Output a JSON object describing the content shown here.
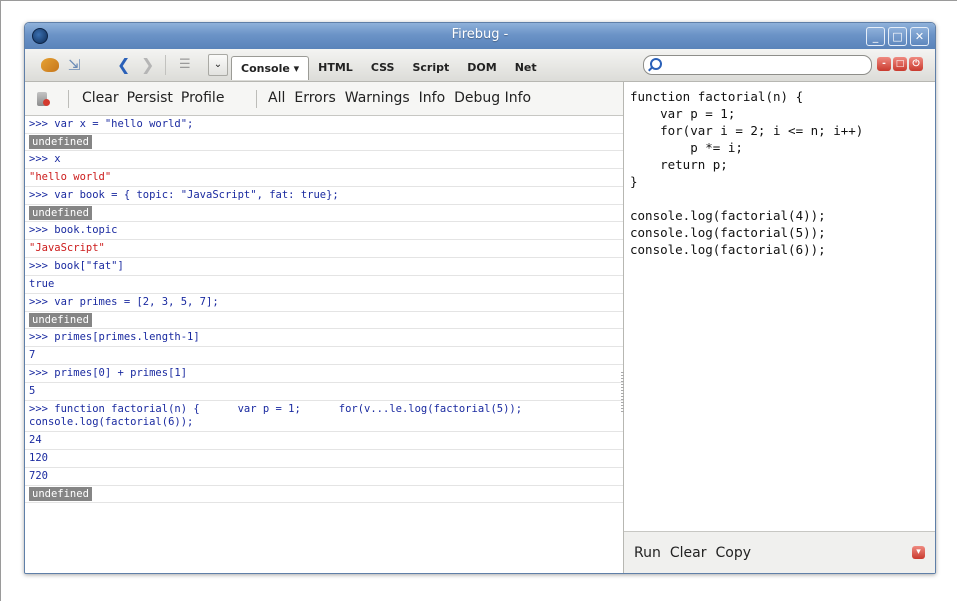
{
  "window": {
    "title": "Firebug -",
    "controls": [
      "_",
      "□",
      "✕"
    ]
  },
  "toolbar": {
    "dropdown_glyph": "⌄",
    "tabs": [
      {
        "label": "Console ▾",
        "active": true
      },
      {
        "label": "HTML"
      },
      {
        "label": "CSS"
      },
      {
        "label": "Script"
      },
      {
        "label": "DOM"
      },
      {
        "label": "Net"
      }
    ],
    "search": {
      "placeholder": ""
    }
  },
  "console_bar": {
    "group1": [
      "Clear",
      "Persist",
      "Profile"
    ],
    "group2": [
      "All",
      "Errors",
      "Warnings",
      "Info",
      "Debug Info"
    ]
  },
  "console_rows": [
    {
      "type": "cmd",
      "text": ">>> var x = \"hello world\";"
    },
    {
      "type": "undef",
      "text": "undefined"
    },
    {
      "type": "cmd",
      "text": ">>> x"
    },
    {
      "type": "str",
      "text": "\"hello world\""
    },
    {
      "type": "cmd",
      "text": ">>> var book = { topic: \"JavaScript\", fat: true};"
    },
    {
      "type": "undef",
      "text": "undefined"
    },
    {
      "type": "cmd",
      "text": ">>> book.topic"
    },
    {
      "type": "str",
      "text": "\"JavaScript\""
    },
    {
      "type": "cmd",
      "text": ">>> book[\"fat\"]"
    },
    {
      "type": "num",
      "text": "true"
    },
    {
      "type": "cmd",
      "text": ">>> var primes = [2, 3, 5, 7];"
    },
    {
      "type": "undef",
      "text": "undefined"
    },
    {
      "type": "cmd",
      "text": ">>> primes[primes.length-1]"
    },
    {
      "type": "num",
      "text": "7"
    },
    {
      "type": "cmd",
      "text": ">>> primes[0] + primes[1]"
    },
    {
      "type": "num",
      "text": "5"
    },
    {
      "type": "cmd",
      "text": ">>> function factorial(n) {      var p = 1;      for(v...le.log(factorial(5));\nconsole.log(factorial(6));"
    },
    {
      "type": "num",
      "text": "24"
    },
    {
      "type": "num",
      "text": "120"
    },
    {
      "type": "num",
      "text": "720"
    },
    {
      "type": "undef",
      "text": "undefined"
    }
  ],
  "editor": {
    "code": "function factorial(n) {\n    var p = 1;\n    for(var i = 2; i <= n; i++)\n        p *= i;\n    return p;\n}\n\nconsole.log(factorial(4));\nconsole.log(factorial(5));\nconsole.log(factorial(6));"
  },
  "editor_footer": {
    "run": "Run",
    "clear": "Clear",
    "copy": "Copy"
  }
}
